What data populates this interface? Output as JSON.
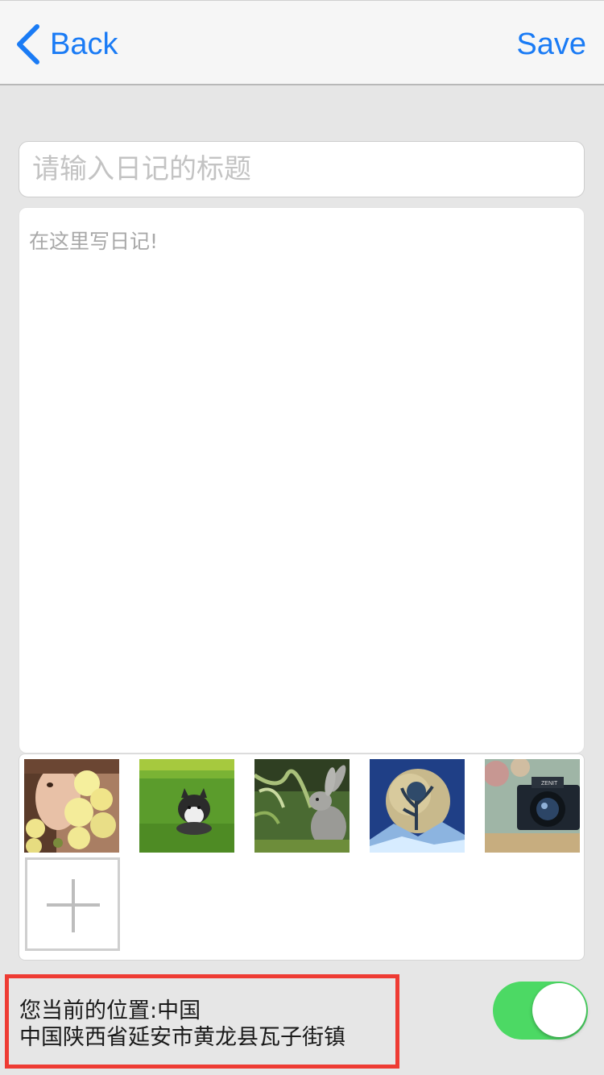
{
  "navbar": {
    "back_label": "Back",
    "save_label": "Save",
    "accent_color": "#1a7bf5"
  },
  "editor": {
    "title_placeholder": "请输入日记的标题",
    "body_placeholder": "在这里写日记!"
  },
  "photos": {
    "items": [
      {
        "icon": "photo-girl-flowers"
      },
      {
        "icon": "photo-husky-grass"
      },
      {
        "icon": "photo-rabbit"
      },
      {
        "icon": "photo-moon-tree"
      },
      {
        "icon": "photo-camera-zenit"
      }
    ],
    "add_icon": "plus-icon"
  },
  "location": {
    "line1": "您当前的位置:中国",
    "line2": "中国陕西省延安市黄龙县瓦子街镇",
    "highlight_color": "#ee3b33"
  },
  "location_toggle": {
    "on": true,
    "color": "#4cd964"
  }
}
